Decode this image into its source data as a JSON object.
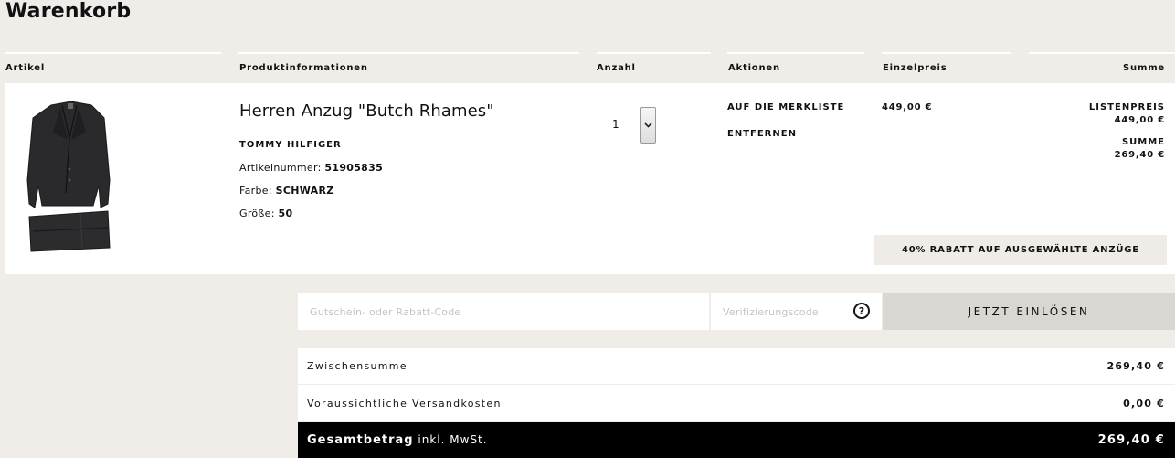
{
  "page": {
    "title": "Warenkorb"
  },
  "columns": {
    "artikel": "Artikel",
    "produktinfo": "Produktinformationen",
    "anzahl": "Anzahl",
    "aktionen": "Aktionen",
    "einzelpreis": "Einzelpreis",
    "summe": "Summe"
  },
  "item": {
    "image_icon": "suit-image",
    "name": "Herren Anzug \"Butch Rhames\"",
    "brand": "TOMMY HILFIGER",
    "article_label": "Artikelnummer:",
    "article_number": "51905835",
    "color_label": "Farbe:",
    "color_value": "SCHWARZ",
    "size_label": "Größe:",
    "size_value": "50",
    "quantity": "1",
    "actions": {
      "wishlist": "AUF DIE MERKLISTE",
      "remove": "ENTFERNEN"
    },
    "unit_price": "449,00 €",
    "list_price_label": "LISTENPREIS",
    "list_price": "449,00 €",
    "sum_label": "SUMME",
    "sum_value": "269,40 €",
    "promo": "40% RABATT AUF AUSGEWÄHLTE ANZÜGE"
  },
  "coupon": {
    "code_placeholder": "Gutschein- oder Rabatt-Code",
    "verify_placeholder": "Verifizierungscode",
    "help_icon": "question-circle-icon",
    "help_glyph": "?",
    "redeem_label": "JETZT EINLÖSEN"
  },
  "totals": {
    "subtotal_label": "Zwischensumme",
    "subtotal_value": "269,40 €",
    "shipping_label": "Voraussichtliche Versandkosten",
    "shipping_value": "0,00 €",
    "grand_label_bold": "Gesamtbetrag",
    "grand_label_rest": "inkl. MwSt.",
    "grand_value": "269,40 €"
  },
  "colors": {
    "page_bg": "#f0ede9",
    "panel_bg": "#ffffff",
    "button_bg": "#d9d7d2",
    "grand_bg": "#000000"
  }
}
